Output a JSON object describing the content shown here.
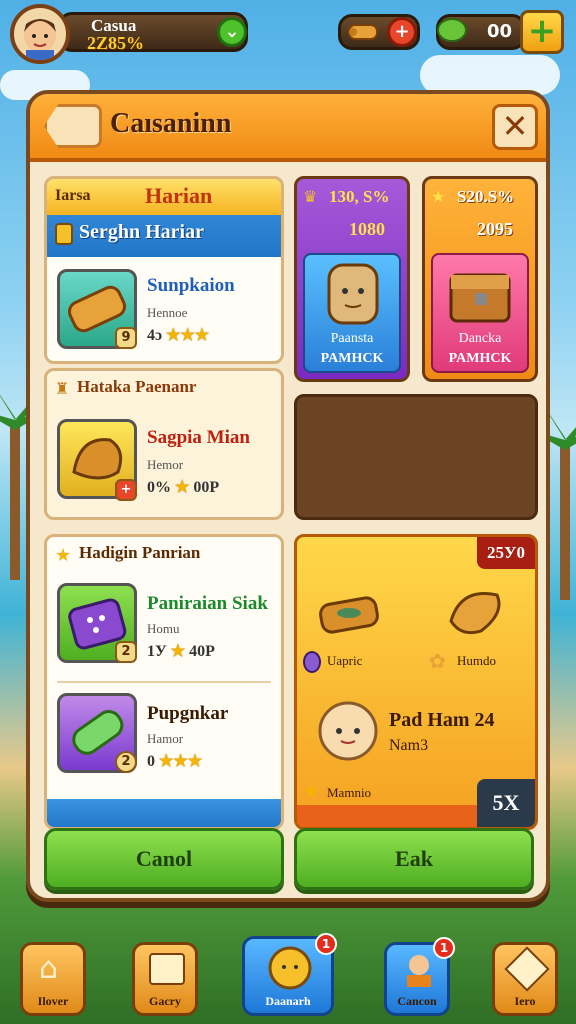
{
  "header": {
    "player_name": "Casua",
    "player_rate": "2Z85%",
    "resource_value": "00"
  },
  "panel": {
    "title": "Caısaninn"
  },
  "left_list": {
    "top_tag": "Iarsa",
    "top_title": "Harian",
    "top_subtitle": "Serghn Hariar",
    "items": [
      {
        "name": "Sunpkaion",
        "sub": "Hennoe",
        "rate": "4ɔ",
        "badge": "9"
      },
      {
        "name": "Sagpia Mian",
        "sub": "Hemor",
        "rate": "0%",
        "rating_text": "00P",
        "badge": "+"
      },
      {
        "name": "Paniraian Siak",
        "sub": "Homu",
        "rate": "1У",
        "rating_text": "40P",
        "badge": "2"
      },
      {
        "name": "Pupgnkar",
        "sub": "Hamor",
        "rate": "0",
        "badge": "2"
      }
    ],
    "section2_title": "Hataka Paenanr",
    "section3_title": "Hadigin Panrian"
  },
  "shop": {
    "card1": {
      "pct": "130, S%",
      "value": "1080",
      "label1": "Paansta",
      "label2": "PAMHCK"
    },
    "card2": {
      "pct": "S20.S%",
      "value": "2095",
      "label1": "Dancka",
      "label2": "PAMHCK"
    },
    "bundle": {
      "badge": "25У0",
      "item1": "Uapric",
      "item2": "Humdo",
      "title": "Pad Ham 24",
      "subtitle": "Nam3",
      "item3": "Mamnio",
      "multiplier": "5X"
    }
  },
  "buttons": {
    "cancel": "Canol",
    "ok": "Eak"
  },
  "nav": [
    {
      "label": "Ilover"
    },
    {
      "label": "Gacry"
    },
    {
      "label": "Daanarh",
      "badge": "1"
    },
    {
      "label": "Cancon",
      "badge": "1"
    },
    {
      "label": "Iero"
    }
  ],
  "colors": {
    "accent": "#f08a14",
    "panel": "#f6e8cc",
    "button_green": "#4fae22"
  }
}
